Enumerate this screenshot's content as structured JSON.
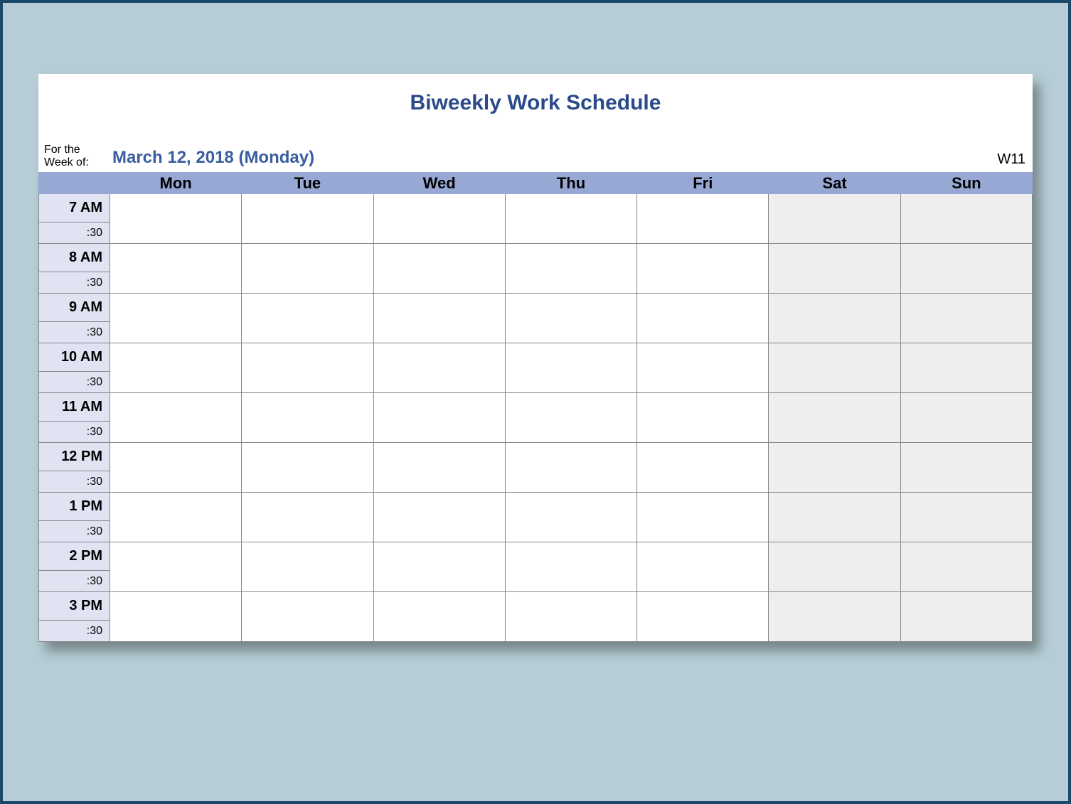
{
  "title": "Biweekly Work Schedule",
  "week_label_line1": "For the",
  "week_label_line2": "Week of:",
  "week_value": "March 12, 2018 (Monday)",
  "week_number": "W11",
  "day_headers": [
    "Mon",
    "Tue",
    "Wed",
    "Thu",
    "Fri",
    "Sat",
    "Sun"
  ],
  "half_label": ":30",
  "hours": [
    "7 AM",
    "8 AM",
    "9 AM",
    "10 AM",
    "11 AM",
    "12 PM",
    "1 PM",
    "2 PM",
    "3 PM"
  ],
  "weekend_indices": [
    5,
    6
  ]
}
